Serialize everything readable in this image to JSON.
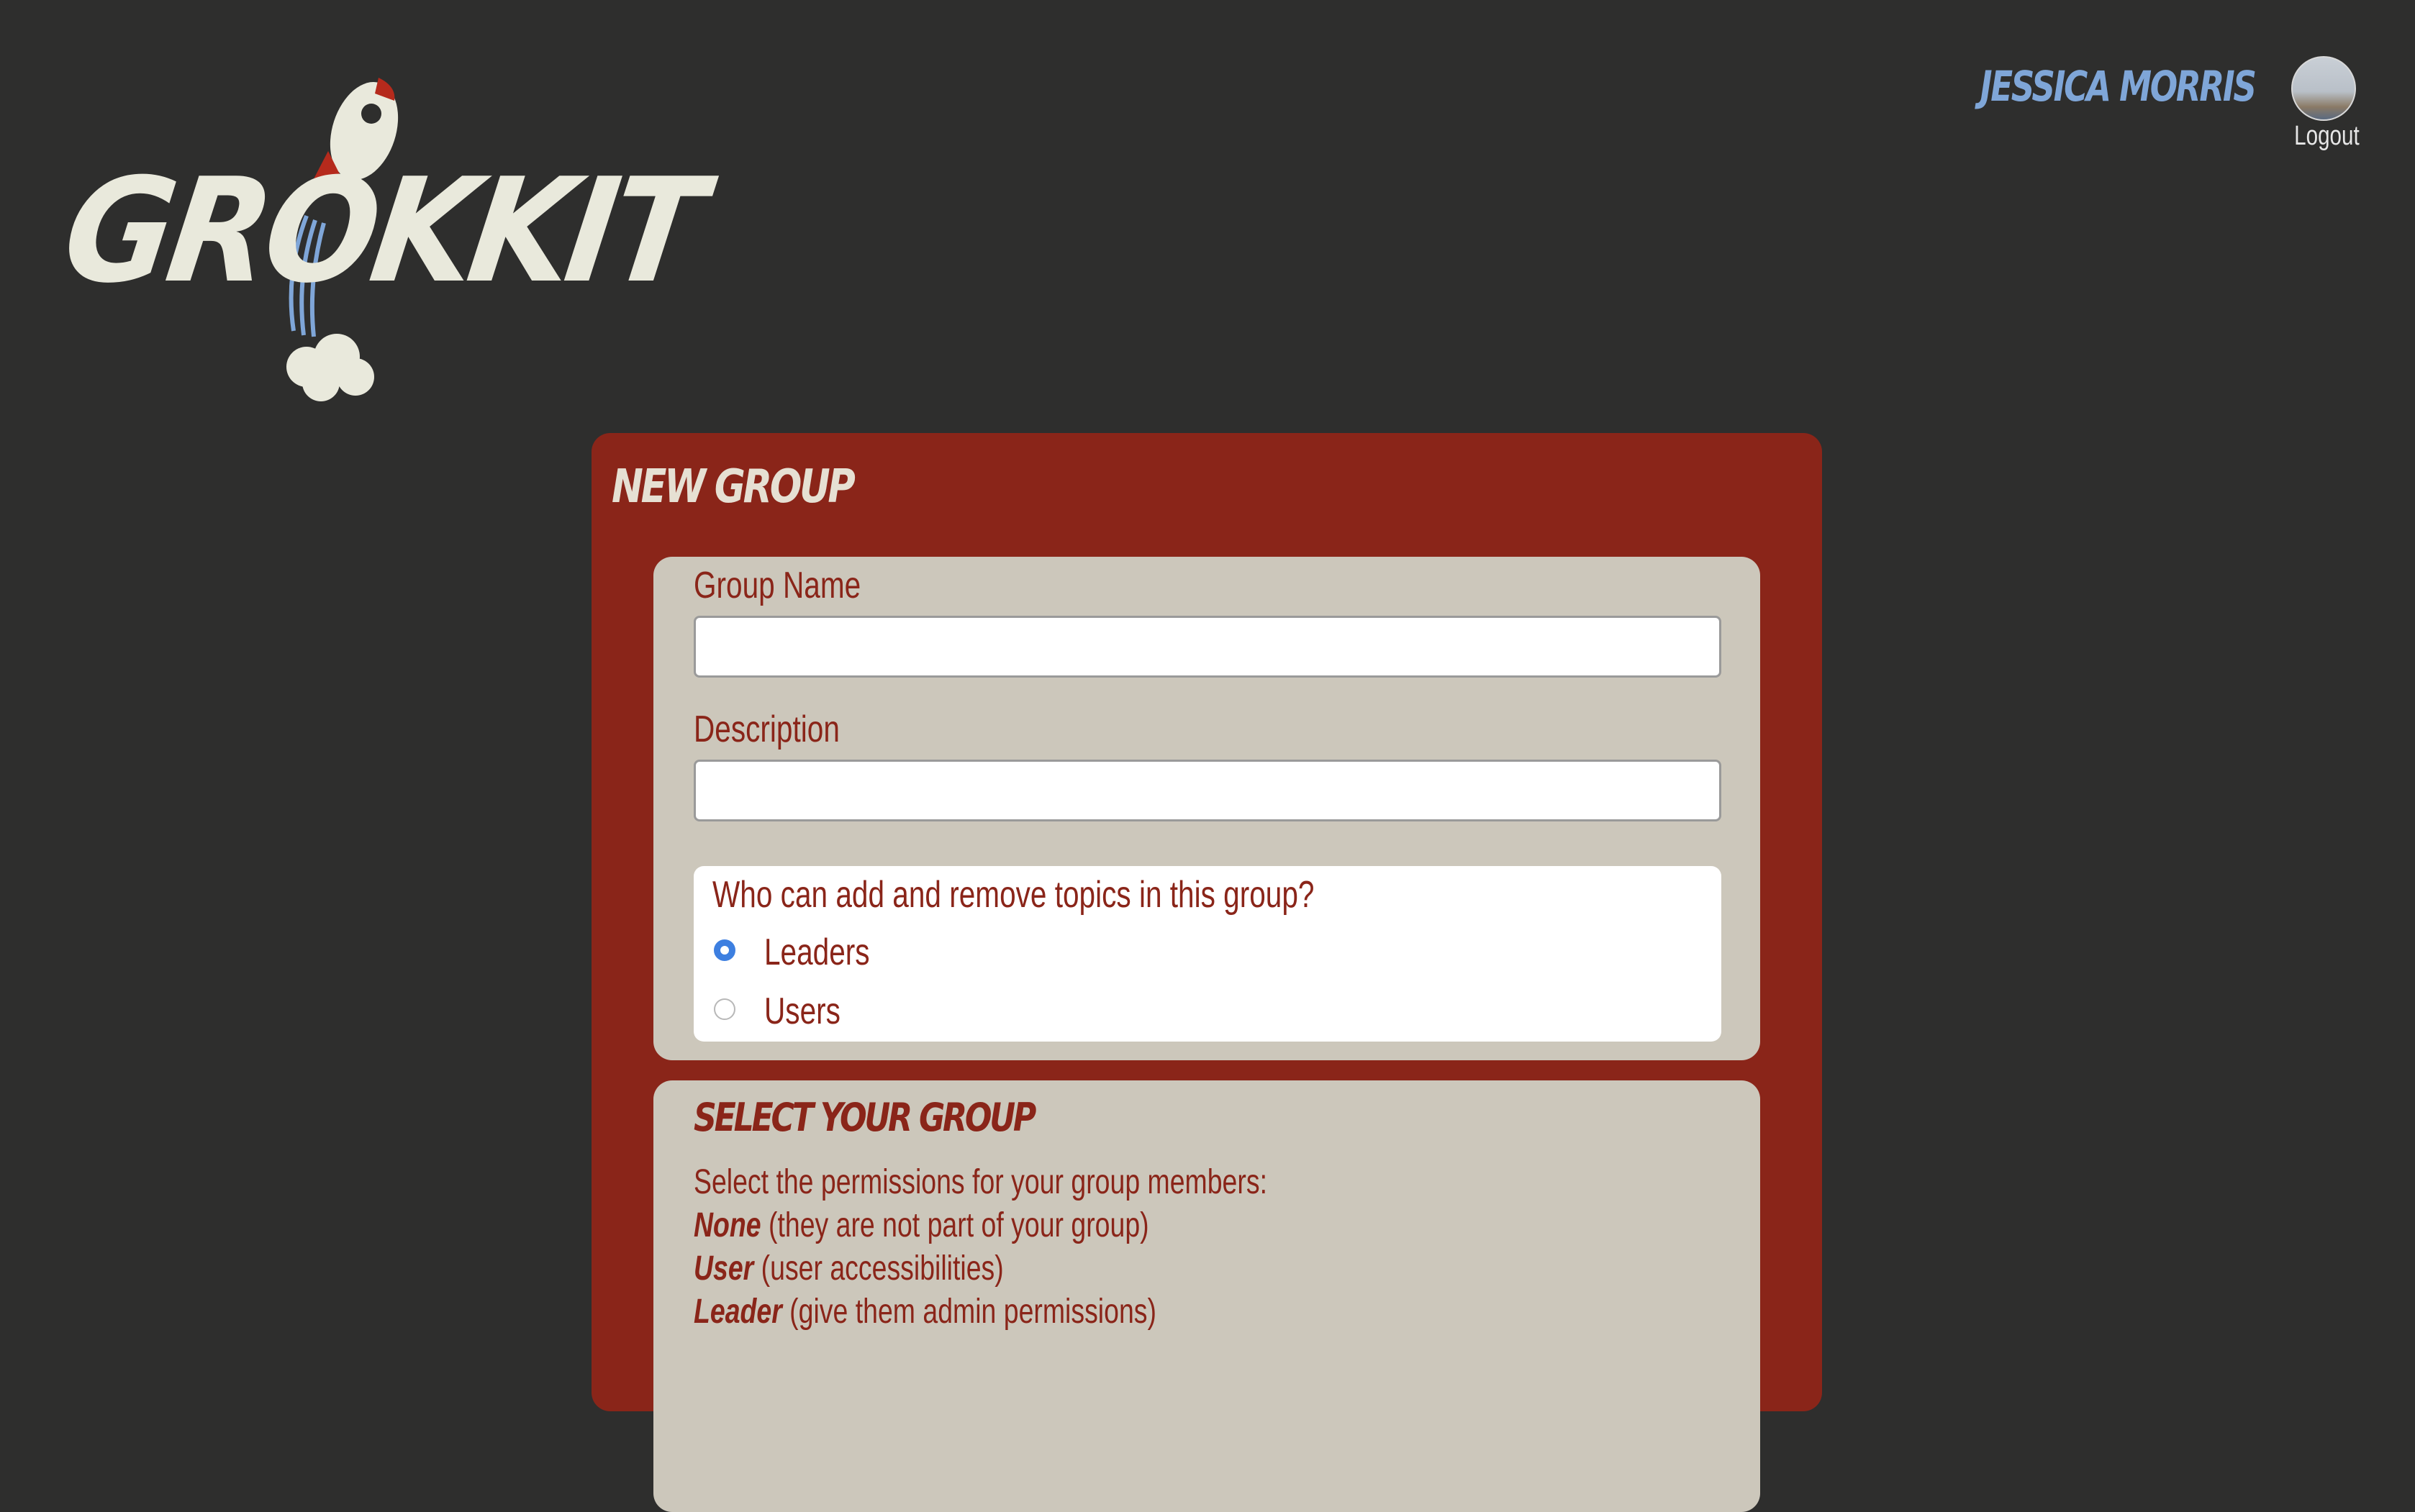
{
  "header": {
    "logo_text": "GROKKIT",
    "user_name": "JESSICA MORRIS",
    "logout_label": "Logout"
  },
  "panel": {
    "title": "NEW GROUP",
    "form": {
      "group_name_label": "Group Name",
      "group_name_value": "",
      "description_label": "Description",
      "description_value": "",
      "topics_question": "Who can add and remove topics in this group?",
      "options": [
        {
          "label": "Leaders",
          "selected": true
        },
        {
          "label": "Users",
          "selected": false
        }
      ]
    },
    "select_group": {
      "title": "SELECT YOUR GROUP",
      "intro": "Select the permissions for your group members:",
      "permissions": [
        {
          "name": "None",
          "desc": "(they are not part of your group)"
        },
        {
          "name": "User",
          "desc": "(user accessibilities)"
        },
        {
          "name": "Leader",
          "desc": "(give them admin permissions)"
        }
      ]
    }
  },
  "colors": {
    "background": "#2e2e2d",
    "panel": "#8a2519",
    "card": "#ccc7bb",
    "accent_blue": "#7fa6d8",
    "radio_on": "#3d7fe0"
  }
}
